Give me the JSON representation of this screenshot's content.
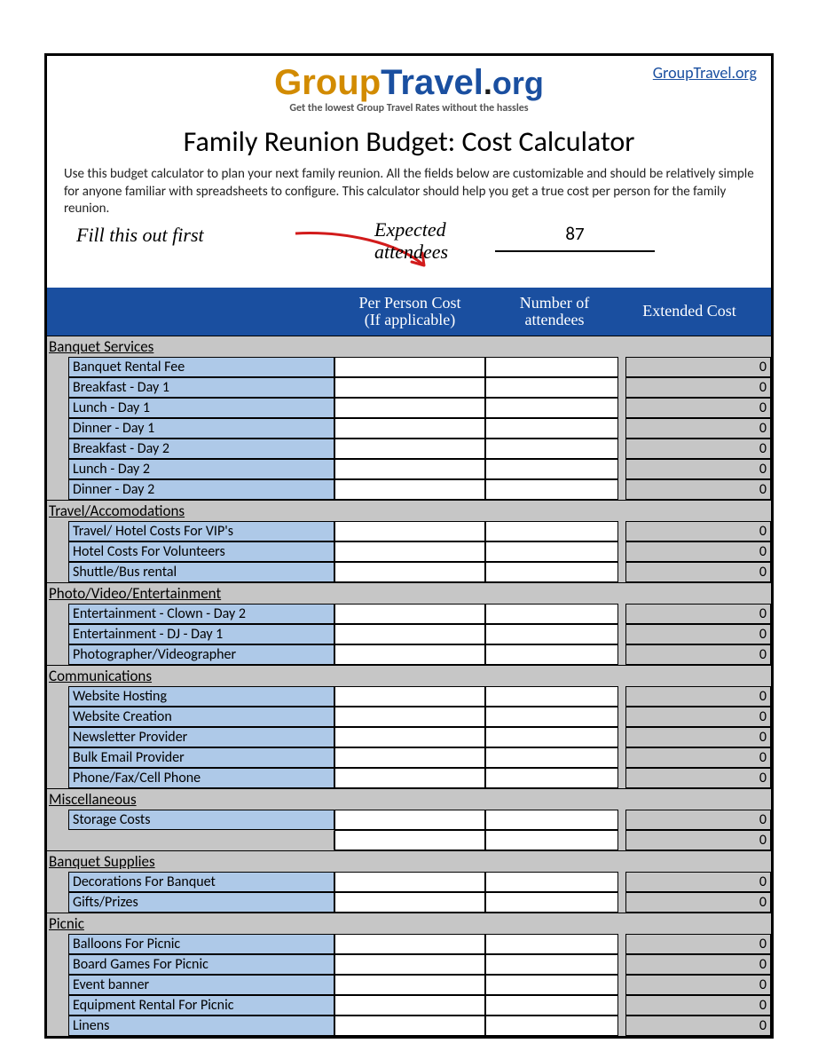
{
  "site_link": "GroupTravel.org",
  "logo": {
    "part1": "Group",
    "part2": "Travel",
    "dot": ".",
    "part3": "org",
    "tagline": "Get the lowest Group Travel Rates without the hassles"
  },
  "title": "Family Reunion Budget: Cost Calculator",
  "description": "Use this budget calculator to plan your next family reunion. All the fields below are customizable and should be relatively simple for anyone familiar with spreadsheets to configure. This calculator should help you get a true cost per person for the family reunion.",
  "fill_first": "Fill this out first",
  "expected_label_1": "Expected",
  "expected_label_2": "attendees",
  "expected_value": "87",
  "columns": {
    "per_person_1": "Per Person Cost",
    "per_person_2": "(If applicable)",
    "attendees_1": "Number of",
    "attendees_2": "attendees",
    "extended": "Extended Cost"
  },
  "sections": [
    {
      "name": "Banquet Services",
      "rows": [
        {
          "label": "Banquet Rental Fee",
          "ext": "0"
        },
        {
          "label": "Breakfast - Day 1",
          "ext": "0"
        },
        {
          "label": "Lunch - Day 1",
          "ext": "0"
        },
        {
          "label": "Dinner - Day 1",
          "ext": "0"
        },
        {
          "label": "Breakfast - Day 2",
          "ext": "0"
        },
        {
          "label": "Lunch - Day 2",
          "ext": "0"
        },
        {
          "label": "Dinner - Day 2",
          "ext": "0"
        }
      ]
    },
    {
      "name": "Travel/Accomodations",
      "rows": [
        {
          "label": "Travel/ Hotel Costs For VIP's",
          "ext": "0"
        },
        {
          "label": "Hotel Costs For Volunteers",
          "ext": "0"
        },
        {
          "label": "Shuttle/Bus rental",
          "ext": "0"
        }
      ]
    },
    {
      "name": "Photo/Video/Entertainment",
      "rows": [
        {
          "label": "Entertainment - Clown - Day 2",
          "ext": "0"
        },
        {
          "label": "Entertainment - DJ - Day 1",
          "ext": "0"
        },
        {
          "label": "Photographer/Videographer",
          "ext": "0"
        }
      ]
    },
    {
      "name": "Communications",
      "rows": [
        {
          "label": "Website Hosting",
          "ext": "0"
        },
        {
          "label": "Website Creation",
          "ext": "0"
        },
        {
          "label": "Newsletter Provider",
          "ext": "0"
        },
        {
          "label": "Bulk Email Provider",
          "ext": "0"
        },
        {
          "label": "Phone/Fax/Cell Phone",
          "ext": "0"
        }
      ]
    },
    {
      "name": "Miscellaneous",
      "rows": [
        {
          "label": "Storage Costs",
          "ext": "0"
        },
        {
          "label": "",
          "ext": "0",
          "blank": true
        }
      ]
    },
    {
      "name": "Banquet Supplies",
      "rows": [
        {
          "label": "Decorations For Banquet",
          "ext": "0"
        },
        {
          "label": "Gifts/Prizes",
          "ext": "0"
        }
      ]
    },
    {
      "name": "Picnic",
      "rows": [
        {
          "label": "Balloons For Picnic",
          "ext": "0"
        },
        {
          "label": "Board Games For Picnic",
          "ext": "0"
        },
        {
          "label": "Event banner",
          "ext": "0"
        },
        {
          "label": "Equipment Rental For Picnic",
          "ext": "0"
        },
        {
          "label": "Linens",
          "ext": "0"
        }
      ]
    }
  ]
}
